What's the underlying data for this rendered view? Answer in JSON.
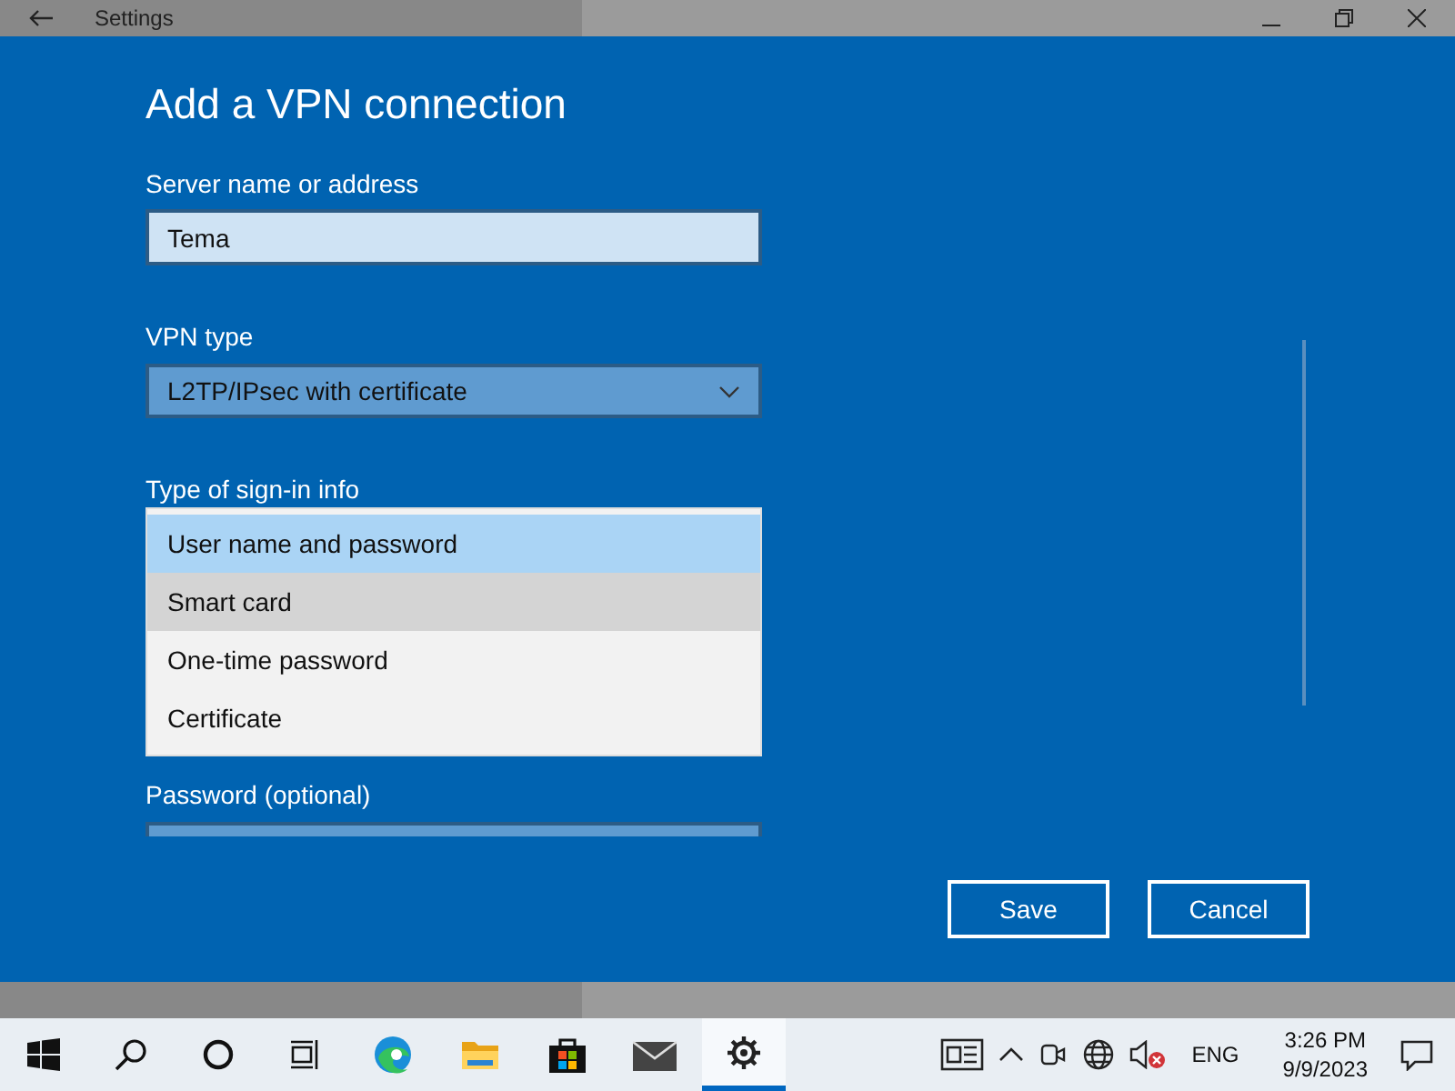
{
  "window": {
    "title": "Settings"
  },
  "dialog": {
    "title": "Add a VPN connection",
    "fields": [
      {
        "kind": "input",
        "label": "Server name or address",
        "value": "Tema"
      },
      {
        "kind": "select",
        "label": "VPN type",
        "value": "L2TP/IPsec with certificate"
      },
      {
        "kind": "list",
        "label": "Type of sign-in info",
        "options": [
          {
            "label": "User name and password",
            "selected": true,
            "highlighted": false
          },
          {
            "label": "Smart card",
            "selected": false,
            "highlighted": true
          },
          {
            "label": "One-time password",
            "selected": false,
            "highlighted": false
          },
          {
            "label": "Certificate",
            "selected": false,
            "highlighted": false
          }
        ]
      },
      {
        "kind": "password",
        "label": "Password (optional)"
      }
    ],
    "buttons": [
      "Save",
      "Cancel"
    ]
  },
  "taskbar": {
    "apps": [
      {
        "kind": "start",
        "selected": false
      },
      {
        "kind": "search",
        "selected": false
      },
      {
        "kind": "cortana",
        "selected": false
      },
      {
        "kind": "taskview",
        "selected": false
      },
      {
        "kind": "edge",
        "selected": false
      },
      {
        "kind": "explorer",
        "selected": false
      },
      {
        "kind": "store",
        "selected": false
      },
      {
        "kind": "mail",
        "selected": false
      },
      {
        "kind": "settings",
        "selected": true
      }
    ],
    "language": "ENG",
    "time": "3:26 PM",
    "date": "9/9/2023"
  }
}
